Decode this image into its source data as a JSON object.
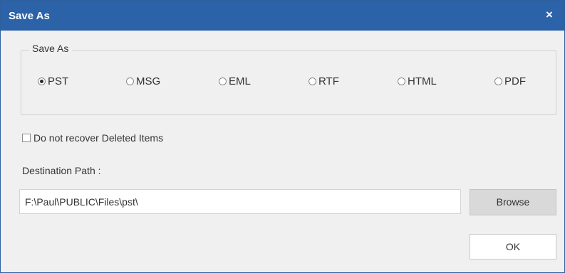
{
  "window": {
    "title": "Save As",
    "close_glyph": "×"
  },
  "save_as_group": {
    "legend": "Save As",
    "options": [
      {
        "label": "PST",
        "checked": true
      },
      {
        "label": "MSG",
        "checked": false
      },
      {
        "label": "EML",
        "checked": false
      },
      {
        "label": "RTF",
        "checked": false
      },
      {
        "label": "HTML",
        "checked": false
      },
      {
        "label": "PDF",
        "checked": false
      }
    ]
  },
  "options": {
    "no_recover_deleted_label": "Do not recover Deleted Items",
    "no_recover_deleted_checked": false
  },
  "destination": {
    "label": "Destination Path :",
    "path_value": "F:\\Paul\\PUBLIC\\Files\\pst\\",
    "browse_label": "Browse"
  },
  "footer": {
    "ok_label": "OK"
  },
  "colors": {
    "titlebar": "#2c62a8",
    "dialog_background": "#f0f0f0",
    "browse_button": "#d9d9d9"
  }
}
